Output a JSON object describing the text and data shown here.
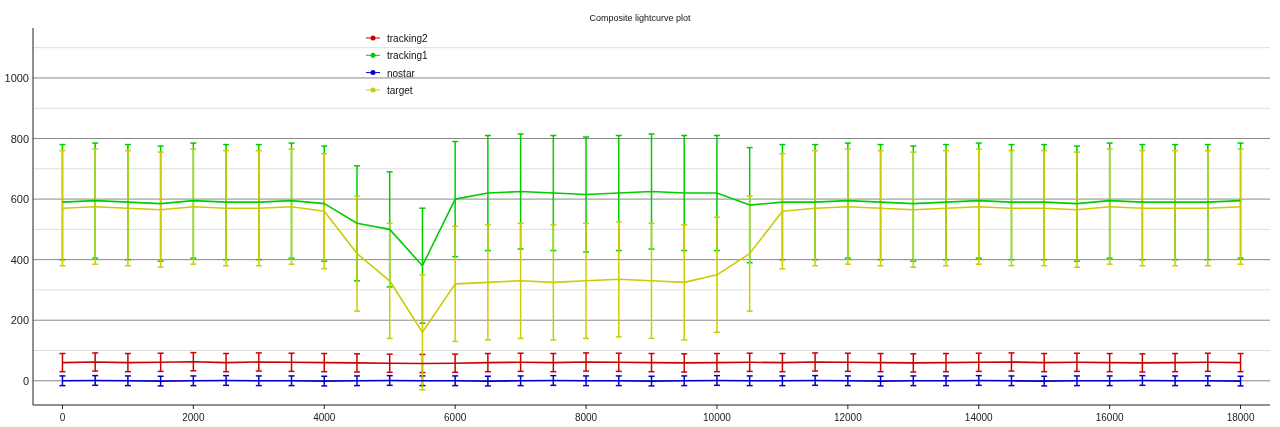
{
  "chart_data": {
    "type": "line",
    "title": "Composite lightcurve plot",
    "x": [
      0,
      500,
      1000,
      1500,
      2000,
      2500,
      3000,
      3500,
      4000,
      4500,
      5000,
      5500,
      6000,
      6500,
      7000,
      7500,
      8000,
      8500,
      9000,
      9500,
      10000,
      10500,
      11000,
      11500,
      12000,
      12500,
      13000,
      13500,
      14000,
      14500,
      15000,
      15500,
      16000,
      16500,
      17000,
      17500,
      18000
    ],
    "series": [
      {
        "name": "tracking2",
        "color": "#cc0000",
        "errors": [
          30,
          30,
          30,
          30,
          30,
          30,
          30,
          30,
          30,
          30,
          30,
          30,
          30,
          30,
          30,
          30,
          30,
          30,
          30,
          30,
          30,
          30,
          30,
          30,
          30,
          30,
          30,
          30,
          30,
          30,
          30,
          30,
          30,
          30,
          30,
          30,
          30
        ],
        "values": [
          60,
          62,
          60,
          61,
          63,
          60,
          62,
          61,
          60,
          59,
          58,
          57,
          58,
          60,
          61,
          60,
          62,
          61,
          60,
          59,
          60,
          61,
          60,
          62,
          61,
          60,
          59,
          60,
          61,
          62,
          60,
          61,
          60,
          59,
          60,
          61,
          60
        ]
      },
      {
        "name": "tracking1",
        "color": "#00cc00",
        "errors": [
          190,
          190,
          190,
          190,
          190,
          190,
          190,
          190,
          190,
          190,
          190,
          190,
          190,
          190,
          190,
          190,
          190,
          190,
          190,
          190,
          190,
          190,
          190,
          190,
          190,
          190,
          190,
          190,
          190,
          190,
          190,
          190,
          190,
          190,
          190,
          190,
          190
        ],
        "values": [
          590,
          595,
          590,
          585,
          595,
          590,
          590,
          595,
          585,
          520,
          500,
          380,
          600,
          620,
          625,
          620,
          615,
          620,
          625,
          620,
          620,
          580,
          590,
          590,
          595,
          590,
          585,
          590,
          595,
          590,
          590,
          585,
          595,
          590,
          590,
          590,
          595
        ]
      },
      {
        "name": "nostar",
        "color": "#0000cc",
        "errors": [
          16,
          16,
          16,
          16,
          16,
          16,
          16,
          16,
          16,
          16,
          16,
          16,
          16,
          16,
          16,
          16,
          16,
          16,
          16,
          16,
          16,
          16,
          16,
          16,
          16,
          16,
          16,
          16,
          16,
          16,
          16,
          16,
          16,
          16,
          16,
          16,
          16
        ],
        "values": [
          0,
          1,
          0,
          -1,
          0,
          1,
          0,
          0,
          -1,
          0,
          1,
          0,
          0,
          -1,
          0,
          1,
          0,
          0,
          -1,
          0,
          1,
          0,
          0,
          1,
          0,
          -1,
          0,
          0,
          1,
          0,
          -1,
          0,
          0,
          1,
          0,
          0,
          -1
        ]
      },
      {
        "name": "target",
        "color": "#cccc00",
        "errors": [
          190,
          190,
          190,
          190,
          190,
          190,
          190,
          190,
          190,
          190,
          190,
          190,
          190,
          190,
          190,
          190,
          190,
          190,
          190,
          190,
          190,
          190,
          190,
          190,
          190,
          190,
          190,
          190,
          190,
          190,
          190,
          190,
          190,
          190,
          190,
          190,
          190
        ],
        "values": [
          570,
          575,
          570,
          565,
          575,
          570,
          570,
          575,
          560,
          420,
          330,
          160,
          320,
          325,
          330,
          325,
          330,
          335,
          330,
          325,
          350,
          420,
          560,
          570,
          575,
          570,
          565,
          570,
          575,
          570,
          570,
          565,
          575,
          570,
          570,
          570,
          575
        ]
      }
    ],
    "xlim": [
      -450,
      18450
    ],
    "ylim": [
      -80,
      1165
    ],
    "grid": true,
    "legend": true,
    "xticks": [
      0,
      2000,
      4000,
      6000,
      8000,
      10000,
      12000,
      14000,
      16000,
      18000
    ],
    "yticks": [
      0,
      200,
      400,
      600,
      800,
      1000
    ]
  }
}
